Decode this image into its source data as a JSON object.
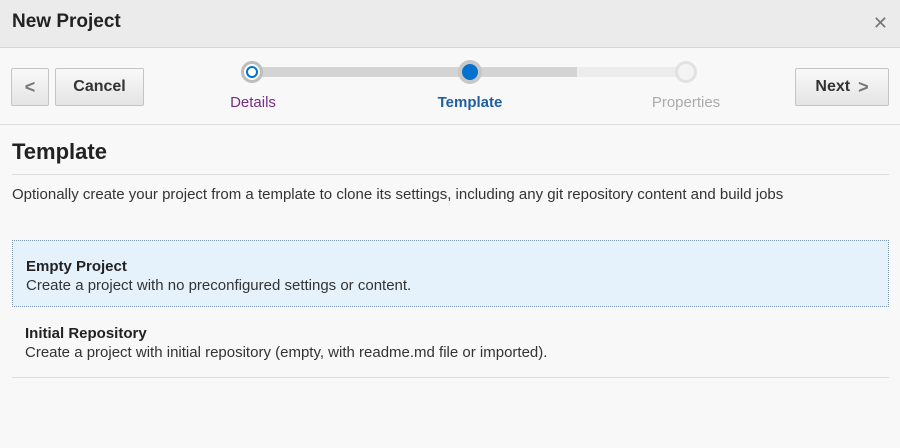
{
  "dialog": {
    "title": "New Project",
    "close_glyph": "✕"
  },
  "train": {
    "prev_glyph": "<",
    "cancel_label": "Cancel",
    "next_label": "Next",
    "next_glyph": ">",
    "stops": [
      {
        "label": "Details",
        "state": "visited"
      },
      {
        "label": "Template",
        "state": "current"
      },
      {
        "label": "Properties",
        "state": "unvisited"
      }
    ]
  },
  "main": {
    "heading": "Template",
    "description": "Optionally create your project from a template to clone its settings, including any git repository content and build jobs",
    "options": [
      {
        "title": "Empty Project",
        "description": "Create a project with no preconfigured settings or content.",
        "selected": true
      },
      {
        "title": "Initial Repository",
        "description": "Create a project with initial repository (empty, with readme.md file or imported).",
        "selected": false
      }
    ]
  },
  "colors": {
    "accent": "#0572ce",
    "visited_label": "#7a2b83",
    "selected_row": "#e6f2fb"
  }
}
